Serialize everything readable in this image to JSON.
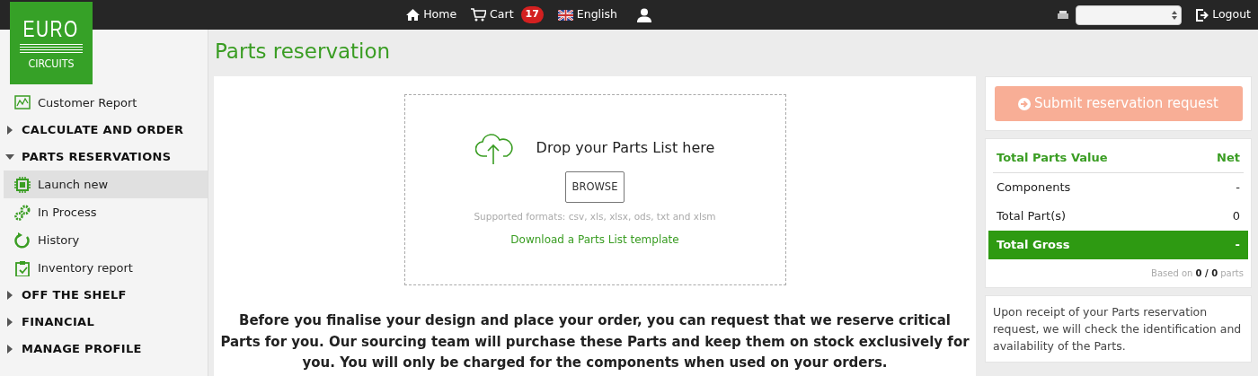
{
  "topbar": {
    "items": [
      {
        "kind": "home",
        "label": "Home"
      },
      {
        "kind": "cart",
        "label": "Cart",
        "badge": "17"
      },
      {
        "kind": "language",
        "label": "English"
      },
      {
        "kind": "user"
      }
    ],
    "logout": "Logout"
  },
  "logo": {
    "line1": "EURO",
    "line2": "CIRCUITS"
  },
  "sidebar": {
    "items": [
      {
        "kind": "link",
        "label": "Customer Report",
        "selected": false
      },
      {
        "kind": "section",
        "label": "CALCULATE AND ORDER",
        "expanded": false
      },
      {
        "kind": "section",
        "label": "PARTS RESERVATIONS",
        "expanded": true,
        "children": [
          {
            "kind": "link",
            "label": "Launch new",
            "selected": true
          },
          {
            "kind": "link",
            "label": "In Process",
            "selected": false
          },
          {
            "kind": "link",
            "label": "History",
            "selected": false
          },
          {
            "kind": "link",
            "label": "Inventory report",
            "selected": false
          }
        ]
      },
      {
        "kind": "section",
        "label": "OFF THE SHELF",
        "expanded": false
      },
      {
        "kind": "section",
        "label": "FINANCIAL",
        "expanded": false
      },
      {
        "kind": "section",
        "label": "MANAGE PROFILE",
        "expanded": false
      }
    ]
  },
  "page_title": "Parts reservation",
  "upload": {
    "title": "Drop your Parts List here",
    "button": "BROWSE",
    "formats": "Supported formats: csv, xls, xlsx, ods, txt and xlsm",
    "template_link": "Download a Parts List template"
  },
  "intro": "Before you finalise your design and place your order, you can request that we reserve critical Parts for you. Our sourcing team will purchase these Parts and keep them on stock exclusively for you. You will only be charged for the components when used on your orders.",
  "submit_button": {
    "label": "Submit reservation request",
    "disabled": true
  },
  "summary": {
    "rows": [
      {
        "kind": "header",
        "label": "Total Parts Value",
        "value": "Net"
      },
      {
        "kind": "row",
        "label": "Components",
        "value": "-"
      },
      {
        "kind": "row",
        "label": "Total Part(s)",
        "value": "0"
      },
      {
        "kind": "total",
        "label": "Total Gross",
        "value": "-"
      }
    ],
    "footnote": "Based on **0 / 0** parts"
  },
  "note": "Upon receipt of your Parts reservation request, we will check the identification and availability of the Parts."
}
